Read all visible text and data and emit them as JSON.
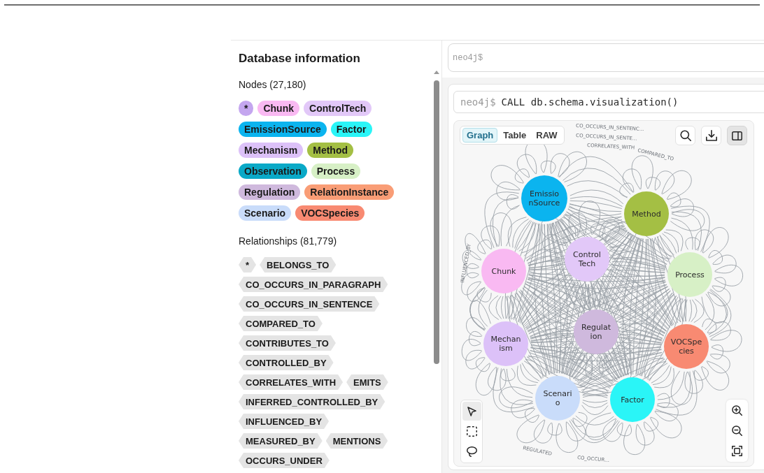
{
  "left_panel": {
    "title": "Database information",
    "nodes_heading": "Nodes (27,180)",
    "node_labels": [
      {
        "label": "*",
        "color": "#c4a6ef"
      },
      {
        "label": "Chunk",
        "color": "#f9b9f2"
      },
      {
        "label": "ControlTech",
        "color": "#e2c8f8"
      },
      {
        "label": "EmissionSource",
        "color": "#0bb4ef"
      },
      {
        "label": "Factor",
        "color": "#2af5f7"
      },
      {
        "label": "Mechanism",
        "color": "#dcc1f8"
      },
      {
        "label": "Method",
        "color": "#a4bf44"
      },
      {
        "label": "Observation",
        "color": "#0aa9c7"
      },
      {
        "label": "Process",
        "color": "#d7f0c6"
      },
      {
        "label": "Regulation",
        "color": "#cfb9dd"
      },
      {
        "label": "RelationInstance",
        "color": "#f99d76"
      },
      {
        "label": "Scenario",
        "color": "#c9dcfa"
      },
      {
        "label": "VOCSpecies",
        "color": "#f88a72"
      }
    ],
    "relationships_heading": "Relationships (81,779)",
    "relationship_types": [
      "*",
      "BELONGS_TO",
      "CO_OCCURS_IN_PARAGRAPH",
      "CO_OCCURS_IN_SENTENCE",
      "COMPARED_TO",
      "CONTRIBUTES_TO",
      "CONTROLLED_BY",
      "CORRELATES_WITH",
      "EMITS",
      "INFERRED_CONTROLLED_BY",
      "INFLUENCED_BY",
      "MEASURED_BY",
      "MENTIONS",
      "OCCURS_UNDER"
    ]
  },
  "editor": {
    "placeholder": "neo4j$"
  },
  "result": {
    "prompt": "neo4j$",
    "query": "CALL db.schema.visualization()",
    "view_tabs": [
      {
        "label": "Graph",
        "selected": true
      },
      {
        "label": "Table",
        "selected": false
      },
      {
        "label": "RAW",
        "selected": false
      }
    ],
    "toolbar": [
      {
        "kind": "search",
        "selected": false
      },
      {
        "kind": "download",
        "selected": false
      },
      {
        "kind": "panel",
        "selected": true
      }
    ],
    "graph": {
      "nodes": [
        {
          "caption_lines": [
            "Emissio",
            "nSource"
          ],
          "color": "#0bb4ef"
        },
        {
          "caption_lines": [
            "Method"
          ],
          "color": "#a4bf44"
        },
        {
          "caption_lines": [
            "Chunk"
          ],
          "color": "#f9b9f2"
        },
        {
          "caption_lines": [
            "Control",
            "Tech"
          ],
          "color": "#e2c8f8"
        },
        {
          "caption_lines": [
            "Process"
          ],
          "color": "#d7f0c6"
        },
        {
          "caption_lines": [
            "Mechan",
            "ism"
          ],
          "color": "#dcc1f8"
        },
        {
          "caption_lines": [
            "Regulat",
            "ion"
          ],
          "color": "#cfb9dd"
        },
        {
          "caption_lines": [
            "VOCSpe",
            "cies"
          ],
          "color": "#f88a72"
        },
        {
          "caption_lines": [
            "Scenari",
            "o"
          ],
          "color": "#c9dcfa"
        },
        {
          "caption_lines": [
            "Factor"
          ],
          "color": "#2af5f7"
        }
      ],
      "edge_labels": [
        "CO_OCCURS_IN_SENTENC…",
        "CO_OCCURS_IN_SENTE…",
        "COMPARED_TO",
        "CORRELATES_WITH",
        "INFLUENCED_BY",
        "REGULATED",
        "CO_OCCUR…"
      ]
    },
    "selection_tools": [
      {
        "kind": "pointer",
        "selected": true
      },
      {
        "kind": "box",
        "selected": false
      },
      {
        "kind": "lasso",
        "selected": false
      }
    ],
    "zoom_controls": [
      {
        "kind": "zoom-in"
      },
      {
        "kind": "zoom-out"
      },
      {
        "kind": "fit"
      }
    ]
  }
}
